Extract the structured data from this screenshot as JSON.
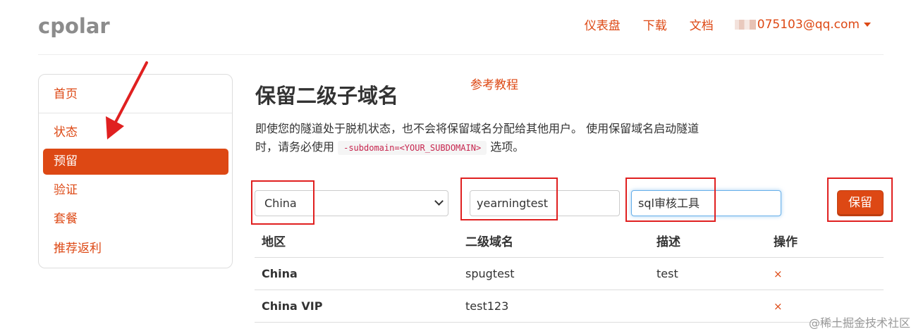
{
  "header": {
    "logo": "cpolar",
    "nav": [
      "仪表盘",
      "下载",
      "文档"
    ],
    "user_email": "075103@qq.com"
  },
  "sidebar": {
    "items": [
      {
        "label": "首页",
        "active": false
      },
      {
        "label": "状态",
        "active": false
      },
      {
        "label": "预留",
        "active": true
      },
      {
        "label": "验证",
        "active": false
      },
      {
        "label": "套餐",
        "active": false
      },
      {
        "label": "推荐返利",
        "active": false
      }
    ]
  },
  "main": {
    "title": "保留二级子域名",
    "tutorial_link": "参考教程",
    "description_1": "即使您的隧道处于脱机状态，也不会将保留域名分配给其他用户。 使用保留域名启动隧道",
    "description_2": "时，请务必使用",
    "description_code": "-subdomain=<YOUR_SUBDOMAIN>",
    "description_3": "选项。"
  },
  "form": {
    "region_selected": "China",
    "subdomain_value": "yearningtest",
    "description_value": "sql审核工具",
    "save_label": "保留"
  },
  "table": {
    "headers": [
      "地区",
      "二级域名",
      "描述",
      "操作"
    ],
    "rows": [
      {
        "region": "China",
        "subdomain": "spugtest",
        "description": "test",
        "action": "×"
      },
      {
        "region": "China VIP",
        "subdomain": "test123",
        "description": "",
        "action": "×"
      }
    ]
  },
  "watermark": "@稀土掘金技术社区",
  "colors": {
    "accent": "#dd4814",
    "highlight_box": "#e02020",
    "focus_border": "#66afe9"
  }
}
